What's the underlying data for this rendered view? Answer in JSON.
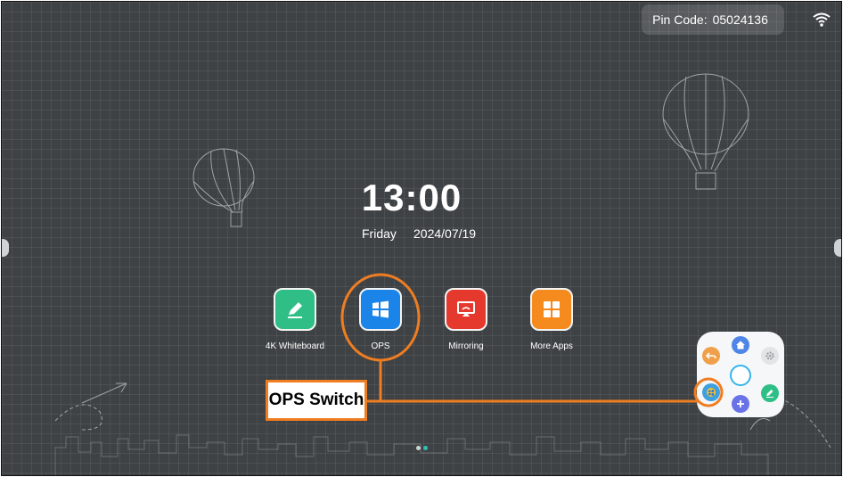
{
  "status_bar": {
    "pin_label": "Pin Code:",
    "pin_value": "05024136"
  },
  "clock": {
    "time": "13:00",
    "weekday": "Friday",
    "date": "2024/07/19"
  },
  "apps": [
    {
      "label": "4K Whiteboard",
      "icon": "whiteboard-pen-icon",
      "color": "#2fbf86"
    },
    {
      "label": "OPS",
      "icon": "windows-icon",
      "color": "#1a84e8"
    },
    {
      "label": "Mirroring",
      "icon": "screen-mirroring-icon",
      "color": "#e5392e"
    },
    {
      "label": "More Apps",
      "icon": "grid-icon",
      "color": "#f58a1f"
    }
  ],
  "annotation": {
    "label": "OPS Switch",
    "color": "#ef7d22"
  },
  "floating_menu": {
    "buttons": [
      "back-icon",
      "home-icon",
      "settings-icon",
      "circle-icon",
      "ops-switch-icon",
      "add-icon",
      "whiteboard-icon"
    ]
  },
  "pager": {
    "active_index": 1,
    "count": 2
  }
}
